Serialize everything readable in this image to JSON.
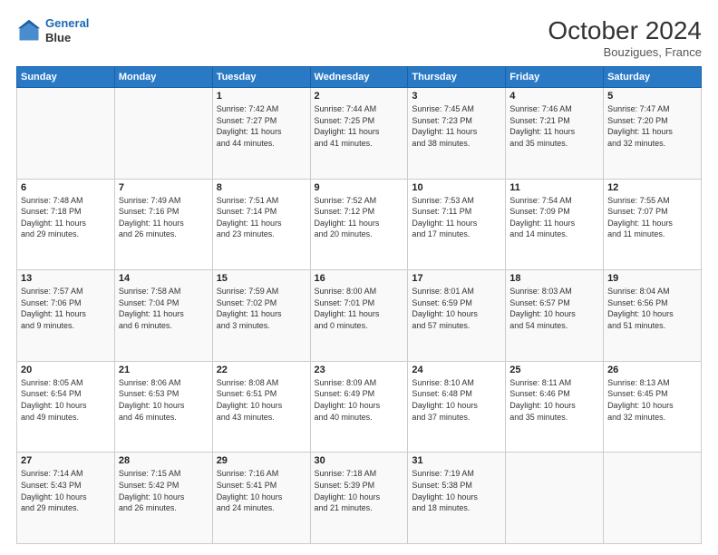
{
  "header": {
    "logo_line1": "General",
    "logo_line2": "Blue",
    "month": "October 2024",
    "location": "Bouzigues, France"
  },
  "weekdays": [
    "Sunday",
    "Monday",
    "Tuesday",
    "Wednesday",
    "Thursday",
    "Friday",
    "Saturday"
  ],
  "weeks": [
    [
      {
        "day": "",
        "info": ""
      },
      {
        "day": "",
        "info": ""
      },
      {
        "day": "1",
        "info": "Sunrise: 7:42 AM\nSunset: 7:27 PM\nDaylight: 11 hours\nand 44 minutes."
      },
      {
        "day": "2",
        "info": "Sunrise: 7:44 AM\nSunset: 7:25 PM\nDaylight: 11 hours\nand 41 minutes."
      },
      {
        "day": "3",
        "info": "Sunrise: 7:45 AM\nSunset: 7:23 PM\nDaylight: 11 hours\nand 38 minutes."
      },
      {
        "day": "4",
        "info": "Sunrise: 7:46 AM\nSunset: 7:21 PM\nDaylight: 11 hours\nand 35 minutes."
      },
      {
        "day": "5",
        "info": "Sunrise: 7:47 AM\nSunset: 7:20 PM\nDaylight: 11 hours\nand 32 minutes."
      }
    ],
    [
      {
        "day": "6",
        "info": "Sunrise: 7:48 AM\nSunset: 7:18 PM\nDaylight: 11 hours\nand 29 minutes."
      },
      {
        "day": "7",
        "info": "Sunrise: 7:49 AM\nSunset: 7:16 PM\nDaylight: 11 hours\nand 26 minutes."
      },
      {
        "day": "8",
        "info": "Sunrise: 7:51 AM\nSunset: 7:14 PM\nDaylight: 11 hours\nand 23 minutes."
      },
      {
        "day": "9",
        "info": "Sunrise: 7:52 AM\nSunset: 7:12 PM\nDaylight: 11 hours\nand 20 minutes."
      },
      {
        "day": "10",
        "info": "Sunrise: 7:53 AM\nSunset: 7:11 PM\nDaylight: 11 hours\nand 17 minutes."
      },
      {
        "day": "11",
        "info": "Sunrise: 7:54 AM\nSunset: 7:09 PM\nDaylight: 11 hours\nand 14 minutes."
      },
      {
        "day": "12",
        "info": "Sunrise: 7:55 AM\nSunset: 7:07 PM\nDaylight: 11 hours\nand 11 minutes."
      }
    ],
    [
      {
        "day": "13",
        "info": "Sunrise: 7:57 AM\nSunset: 7:06 PM\nDaylight: 11 hours\nand 9 minutes."
      },
      {
        "day": "14",
        "info": "Sunrise: 7:58 AM\nSunset: 7:04 PM\nDaylight: 11 hours\nand 6 minutes."
      },
      {
        "day": "15",
        "info": "Sunrise: 7:59 AM\nSunset: 7:02 PM\nDaylight: 11 hours\nand 3 minutes."
      },
      {
        "day": "16",
        "info": "Sunrise: 8:00 AM\nSunset: 7:01 PM\nDaylight: 11 hours\nand 0 minutes."
      },
      {
        "day": "17",
        "info": "Sunrise: 8:01 AM\nSunset: 6:59 PM\nDaylight: 10 hours\nand 57 minutes."
      },
      {
        "day": "18",
        "info": "Sunrise: 8:03 AM\nSunset: 6:57 PM\nDaylight: 10 hours\nand 54 minutes."
      },
      {
        "day": "19",
        "info": "Sunrise: 8:04 AM\nSunset: 6:56 PM\nDaylight: 10 hours\nand 51 minutes."
      }
    ],
    [
      {
        "day": "20",
        "info": "Sunrise: 8:05 AM\nSunset: 6:54 PM\nDaylight: 10 hours\nand 49 minutes."
      },
      {
        "day": "21",
        "info": "Sunrise: 8:06 AM\nSunset: 6:53 PM\nDaylight: 10 hours\nand 46 minutes."
      },
      {
        "day": "22",
        "info": "Sunrise: 8:08 AM\nSunset: 6:51 PM\nDaylight: 10 hours\nand 43 minutes."
      },
      {
        "day": "23",
        "info": "Sunrise: 8:09 AM\nSunset: 6:49 PM\nDaylight: 10 hours\nand 40 minutes."
      },
      {
        "day": "24",
        "info": "Sunrise: 8:10 AM\nSunset: 6:48 PM\nDaylight: 10 hours\nand 37 minutes."
      },
      {
        "day": "25",
        "info": "Sunrise: 8:11 AM\nSunset: 6:46 PM\nDaylight: 10 hours\nand 35 minutes."
      },
      {
        "day": "26",
        "info": "Sunrise: 8:13 AM\nSunset: 6:45 PM\nDaylight: 10 hours\nand 32 minutes."
      }
    ],
    [
      {
        "day": "27",
        "info": "Sunrise: 7:14 AM\nSunset: 5:43 PM\nDaylight: 10 hours\nand 29 minutes."
      },
      {
        "day": "28",
        "info": "Sunrise: 7:15 AM\nSunset: 5:42 PM\nDaylight: 10 hours\nand 26 minutes."
      },
      {
        "day": "29",
        "info": "Sunrise: 7:16 AM\nSunset: 5:41 PM\nDaylight: 10 hours\nand 24 minutes."
      },
      {
        "day": "30",
        "info": "Sunrise: 7:18 AM\nSunset: 5:39 PM\nDaylight: 10 hours\nand 21 minutes."
      },
      {
        "day": "31",
        "info": "Sunrise: 7:19 AM\nSunset: 5:38 PM\nDaylight: 10 hours\nand 18 minutes."
      },
      {
        "day": "",
        "info": ""
      },
      {
        "day": "",
        "info": ""
      }
    ]
  ]
}
